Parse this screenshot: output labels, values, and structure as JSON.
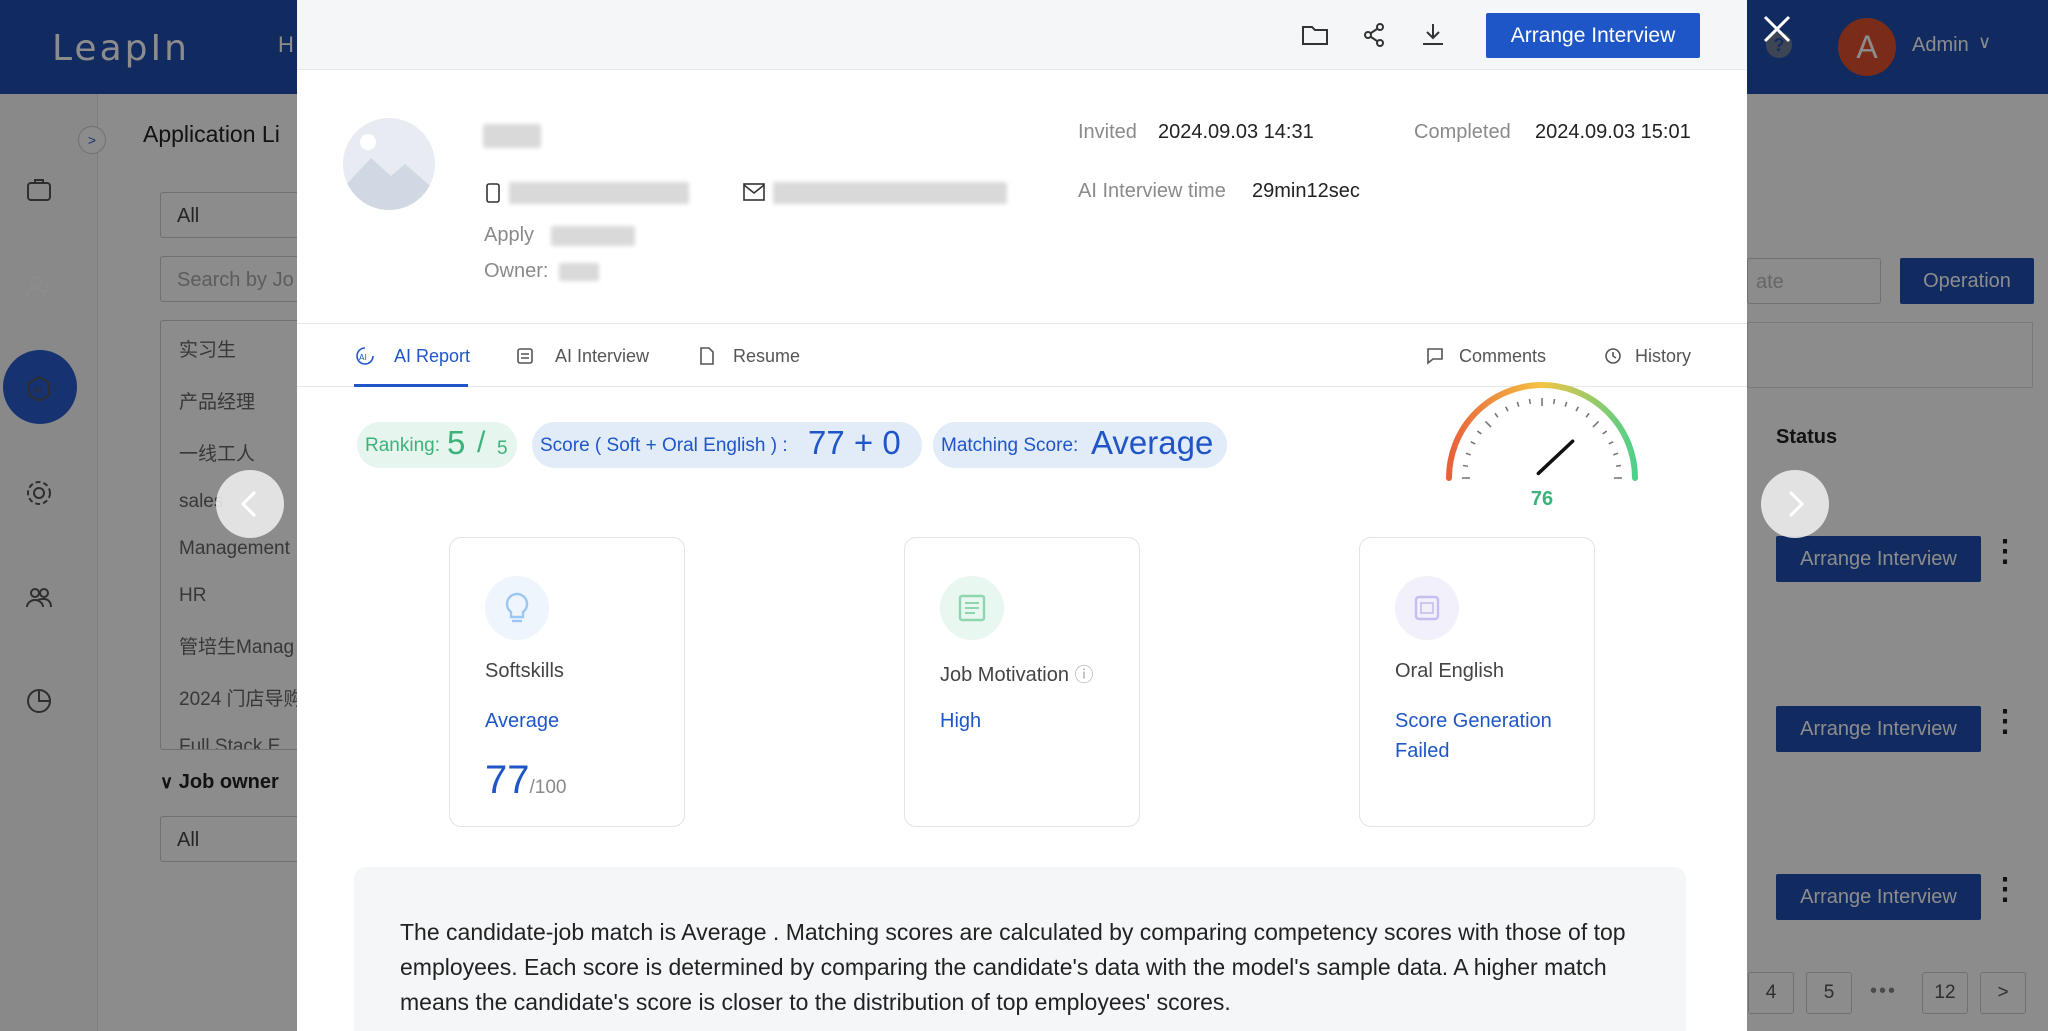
{
  "app": {
    "logo": "LeapIn",
    "nav_partial": "H",
    "help": "?",
    "avatar_letter": "A",
    "user_name": "Admin",
    "user_chevron": "∨"
  },
  "background": {
    "page_title": "Application Li",
    "expand": ">",
    "filter_select": "All",
    "search_placeholder": "Search by Jo",
    "job_list": [
      "实习生",
      "产品经理",
      "一线工人",
      "sales",
      "Management",
      "HR",
      "管培生Manag",
      "2024 门店导购",
      "Full Stack E"
    ],
    "job_owner_label": "Job owner",
    "owner_select": "All",
    "date_placeholder": "ate",
    "operation_label": "Operation",
    "status_header": "Status",
    "row_action_label": "Arrange Interview",
    "pagination": [
      "4",
      "5",
      "•••",
      "12",
      ">"
    ]
  },
  "modal": {
    "arrange_button": "Arrange Interview",
    "candidate": {
      "name": "xxxx",
      "apply_label": "Apply",
      "apply_value": "",
      "owner_label": "Owner:",
      "owner_value": ""
    },
    "meta": {
      "invited_label": "Invited",
      "invited_value": "2024.09.03 14:31",
      "completed_label": "Completed",
      "completed_value": "2024.09.03 15:01",
      "duration_label": "AI Interview time",
      "duration_value": "29min12sec"
    },
    "tabs": {
      "ai_report": "AI Report",
      "ai_interview": "AI Interview",
      "resume": "Resume",
      "comments": "Comments",
      "history": "History"
    },
    "summary": {
      "ranking_label": "Ranking:",
      "ranking_value": "5",
      "ranking_sep": "/",
      "ranking_total": "5",
      "score_label": "Score ( Soft + Oral English ) :",
      "score_value": "77 + 0",
      "matching_label": "Matching Score:",
      "matching_value": "Average"
    },
    "gauge": {
      "value": "76",
      "fraction": 0.76
    },
    "cards": [
      {
        "title": "Softskills",
        "level": "Average",
        "score": "77",
        "max": "/100",
        "icon": "lightbulb-icon"
      },
      {
        "title": "Job Motivation",
        "level": "High",
        "icon": "document-icon",
        "info_icon": "ⓘ"
      },
      {
        "title": "Oral English",
        "level": "Score Generation Failed",
        "icon": "english-icon"
      }
    ],
    "description": "The candidate-job match is Average . Matching scores are calculated by comparing competency scores with those of top employees. Each score is determined by comparing the candidate's data with the model's sample data. A higher match means the candidate's score is closer to the distribution of top employees' scores."
  },
  "colors": {
    "brand": "#1f4db0",
    "accent": "#1f56c7",
    "green": "#3bb37a",
    "avatar": "#e0502f"
  }
}
